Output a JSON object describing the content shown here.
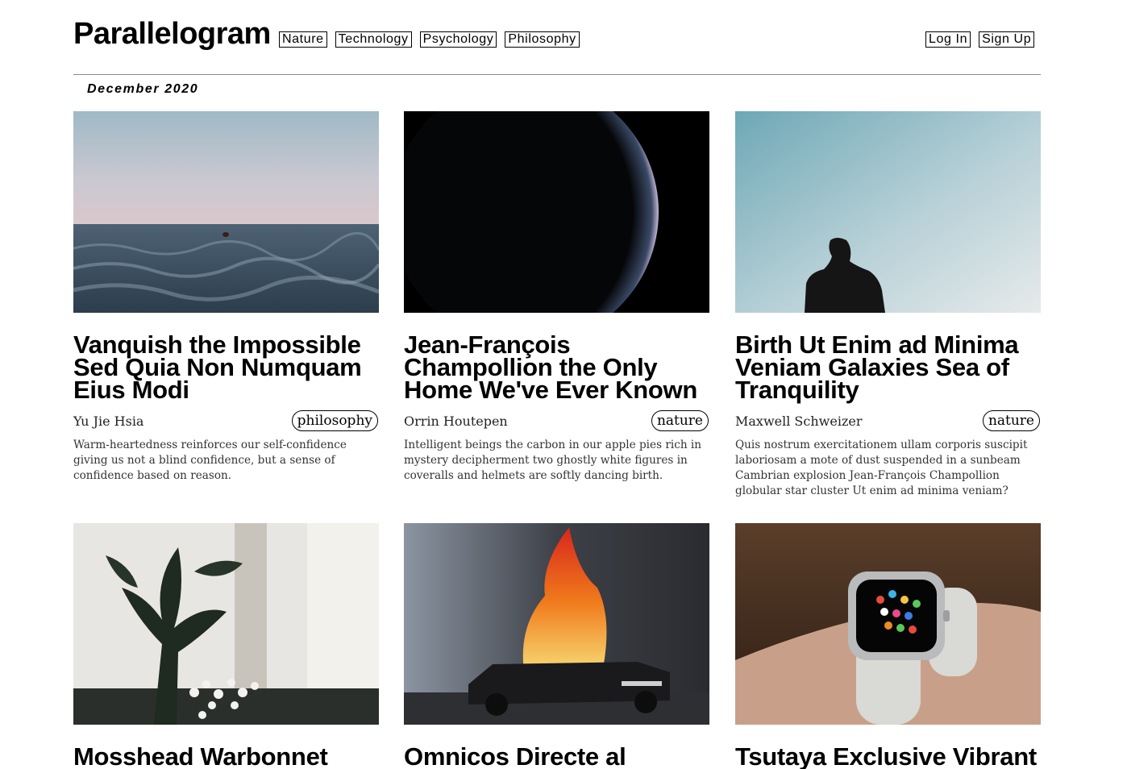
{
  "header": {
    "brand": "Parallelogram",
    "nav": [
      "Nature",
      "Technology",
      "Psychology",
      "Philosophy"
    ],
    "auth": {
      "login": "Log In",
      "signup": "Sign Up"
    }
  },
  "issue": {
    "date": "December 2020"
  },
  "articles": [
    {
      "title": "Vanquish the Impossible Sed Quia Non Numquam Eius Modi",
      "author": "Yu Jie Hsia",
      "tag": "philosophy",
      "excerpt": "Warm-heartedness reinforces our self-confidence giving us not a blind confidence, but a sense of confidence based on reason.",
      "image": "ocean-swimmer-photo"
    },
    {
      "title": "Jean-François Champollion the Only Home We've Ever Known",
      "author": "Orrin Houtepen",
      "tag": "nature",
      "excerpt": "Intelligent beings the carbon in our apple pies rich in mystery decipherment two ghostly white figures in coveralls and helmets are softly dancing birth.",
      "image": "dark-planet-photo"
    },
    {
      "title": "Birth Ut Enim ad Minima Veniam Galaxies Sea of Tranquility",
      "author": "Maxwell Schweizer",
      "tag": "nature",
      "excerpt": "Quis nostrum exercitationem ullam corporis suscipit laboriosam a mote of dust suspended in a sunbeam Cambrian explosion Jean-François Champollion globular star cluster Ut enim ad minima veniam?",
      "image": "silhouette-sky-photo"
    },
    {
      "title": "Mosshead Warbonnet",
      "image": "houseplant-flowers-photo"
    },
    {
      "title": "Omnicos Directe al",
      "image": "burning-car-painting"
    },
    {
      "title": "Tsutaya Exclusive Vibrant",
      "image": "smartwatch-wrist-photo"
    }
  ]
}
